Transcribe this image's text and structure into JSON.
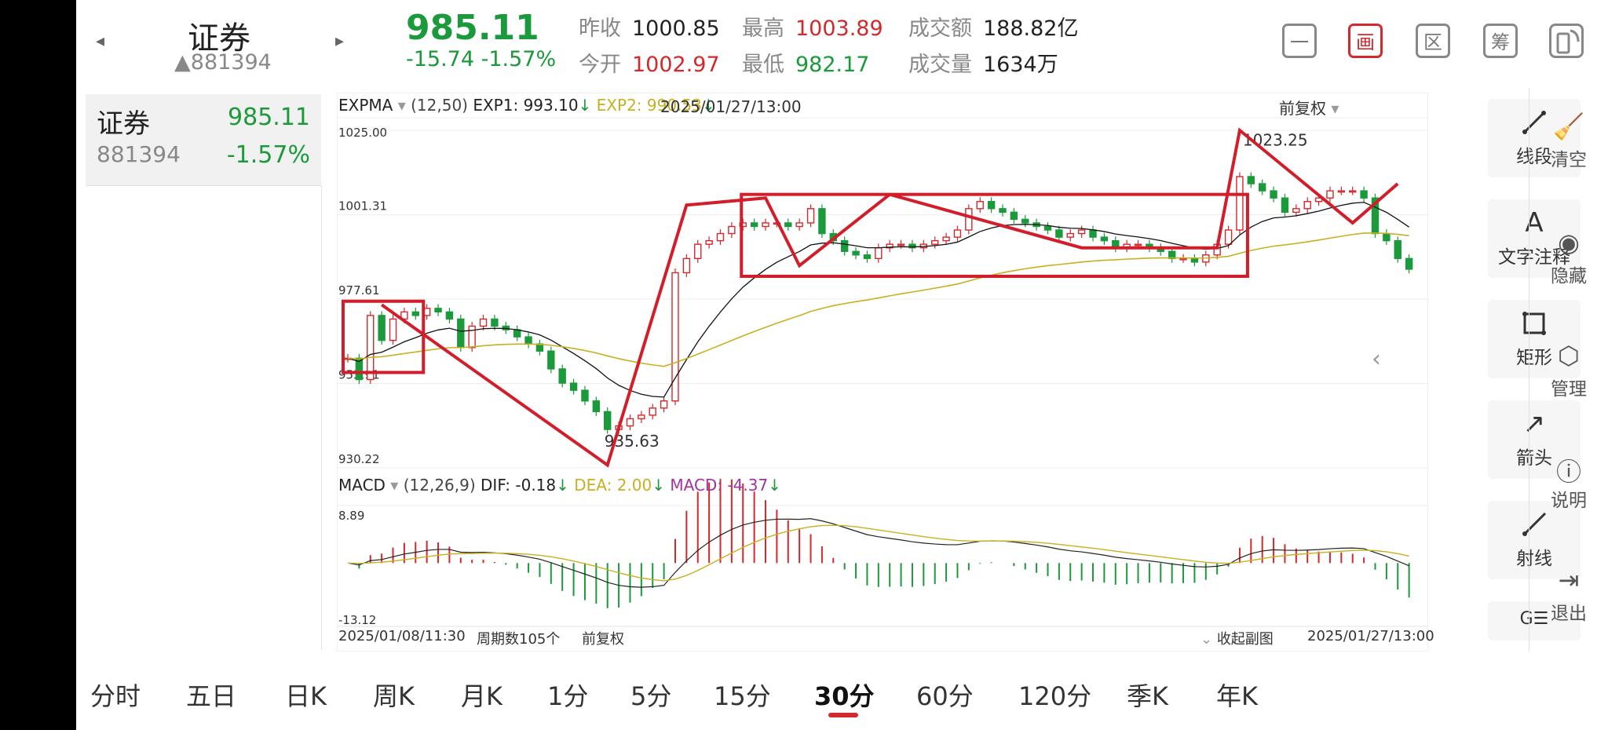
{
  "header": {
    "name": "证券",
    "code": "▲881394",
    "price": "985.11",
    "change": "-15.74  -1.57%",
    "prev_close_label": "昨收",
    "prev_close": "1000.85",
    "open_label": "今开",
    "open": "1002.97",
    "high_label": "最高",
    "high": "1003.89",
    "low_label": "最低",
    "low": "982.17",
    "amount_label": "成交额",
    "amount": "188.82亿",
    "volume_label": "成交量",
    "volume": "1634万",
    "buttons": [
      "一",
      "画",
      "区",
      "筹",
      ""
    ]
  },
  "sidebar": {
    "name": "证券",
    "price": "985.11",
    "code": "881394",
    "pct": "-1.57%"
  },
  "indicator_top": {
    "name": "EXPMA",
    "params": "(12,50)",
    "exp1": "EXP1: 993.10",
    "exp2": "EXP2: 990.53",
    "date": "2025/01/27/13:00",
    "adjust": "前复权"
  },
  "indicator_bottom": {
    "name": "MACD",
    "params": "(12,26,9)",
    "dif": "DIF: -0.18",
    "dea": "DEA: 2.00",
    "macd": "MACD: -4.37"
  },
  "footer": {
    "start_date": "2025/01/08/11:30",
    "periods": "周期数105个",
    "adjust": "前复权",
    "collapse": "收起副图",
    "end_date": "2025/01/27/13:00"
  },
  "tools": [
    {
      "label": "线段",
      "icon": "line-segment-icon"
    },
    {
      "label": "文字注释",
      "icon": "text-annotation-icon"
    },
    {
      "label": "矩形",
      "icon": "rectangle-icon"
    },
    {
      "label": "箭头",
      "icon": "arrow-icon"
    },
    {
      "label": "射线",
      "icon": "ray-icon"
    }
  ],
  "right_actions": [
    {
      "label": "清空",
      "icon": "clear-icon"
    },
    {
      "label": "隐藏",
      "icon": "eye-icon"
    },
    {
      "label": "管理",
      "icon": "manage-icon"
    },
    {
      "label": "说明",
      "icon": "help-icon"
    },
    {
      "label": "退出",
      "icon": "exit-icon"
    }
  ],
  "tabs": [
    "分时",
    "五日",
    "日K",
    "周K",
    "月K",
    "1分",
    "5分",
    "15分",
    "30分",
    "60分",
    "120分",
    "季K",
    "年K"
  ],
  "active_tab": "30分",
  "chart_data": [
    {
      "type": "candlestick",
      "title": "EXPMA",
      "y_ticks": [
        "1025.00",
        "1001.31",
        "977.61",
        "953.91",
        "930.22"
      ],
      "ylim": [
        930.22,
        1025.0
      ],
      "annotations": [
        "935.63",
        "1023.25"
      ],
      "close": [
        961,
        955,
        973,
        966,
        972,
        974,
        973,
        975,
        974,
        972,
        964,
        970,
        972,
        970,
        969,
        967,
        965,
        963,
        958,
        954,
        952,
        949,
        946,
        941,
        942,
        944,
        945,
        947,
        949,
        985,
        989,
        993,
        994,
        996,
        998,
        999,
        998,
        999,
        999,
        998,
        999,
        1003,
        996,
        994,
        991,
        990,
        989,
        992,
        993,
        993,
        992,
        993,
        994,
        995,
        997,
        1003,
        1005,
        1003,
        1002,
        1000,
        999,
        998,
        997,
        995,
        996,
        997,
        995,
        994,
        992,
        993,
        993,
        992,
        991,
        989,
        989,
        988,
        990,
        993,
        997,
        1012,
        1010,
        1008,
        1006,
        1002,
        1003,
        1005,
        1006,
        1008,
        1008,
        1008,
        1006,
        996,
        994,
        989,
        986
      ],
      "series": [
        {
          "name": "EXP1",
          "color": "#111111"
        },
        {
          "name": "EXP2",
          "color": "#c8b020"
        }
      ]
    },
    {
      "type": "bar",
      "title": "MACD",
      "y_ticks": [
        "8.89",
        "-13.12"
      ],
      "ylim": [
        -13.12,
        8.89
      ],
      "series": [
        {
          "name": "DIF",
          "color": "#222222"
        },
        {
          "name": "DEA",
          "color": "#c8b020"
        },
        {
          "name": "MACD",
          "color": "#a033a0"
        }
      ]
    }
  ],
  "colors": {
    "up": "#d4282c",
    "down": "#1a9a3a",
    "exp2": "#c8b020",
    "macd": "#a033a0"
  }
}
